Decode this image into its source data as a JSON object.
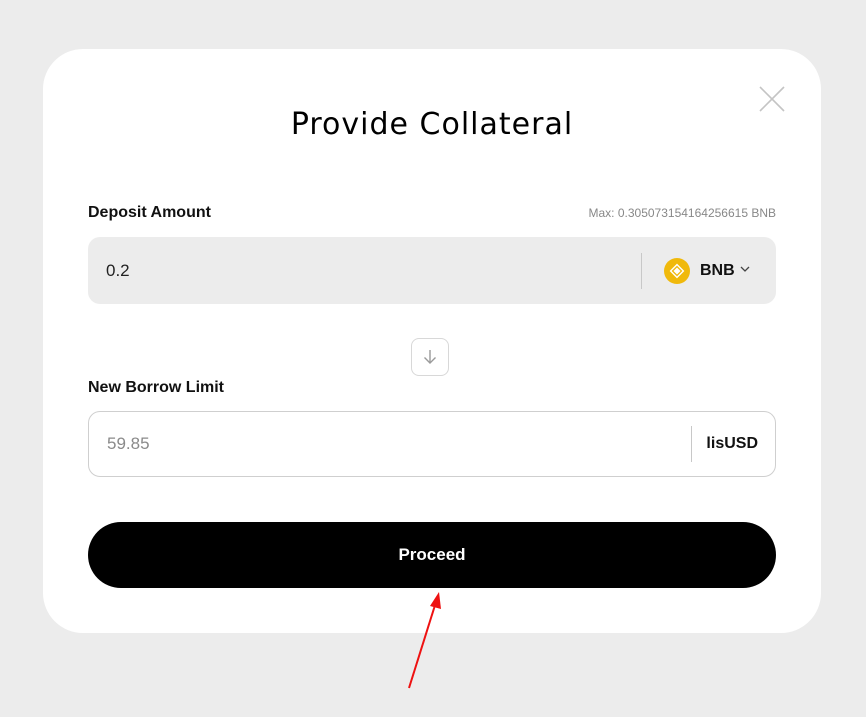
{
  "modal": {
    "title": "Provide Collateral",
    "close_icon": "close-icon"
  },
  "deposit": {
    "label": "Deposit Amount",
    "max_text": "Max: 0.305073154164256615 BNB",
    "value": "0.2",
    "token": {
      "icon": "bnb-icon",
      "label": "BNB",
      "chevron_icon": "chevron-down-icon"
    }
  },
  "separator": {
    "icon": "arrow-down-icon"
  },
  "borrow": {
    "label": "New Borrow Limit",
    "value": "59.85",
    "unit": "lisUSD"
  },
  "proceed_button": {
    "label": "Proceed"
  },
  "colors": {
    "background": "#ececec",
    "modal": "#ffffff",
    "field_fill": "#ececec",
    "button": "#000000",
    "bnb": "#f0b90b",
    "annotation_arrow": "#ee1111"
  }
}
